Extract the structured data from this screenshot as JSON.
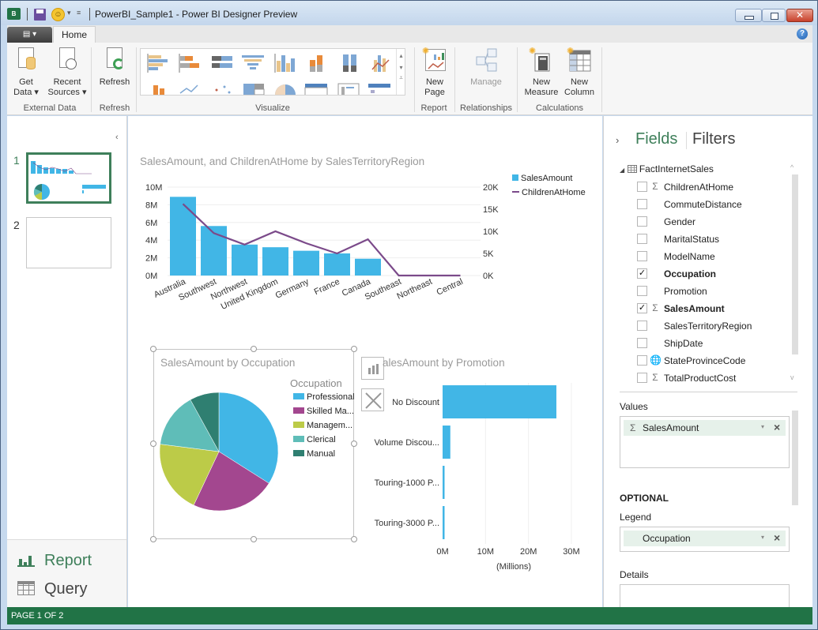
{
  "window": {
    "title": "PowerBI_Sample1 - Power BI Designer Preview",
    "app_icon_label": "B",
    "close_glyph": "✕"
  },
  "ribbon": {
    "file_menu_glyph": "▤ ▾",
    "tabs": [
      {
        "label": "Home",
        "active": true
      }
    ],
    "help_glyph": "?",
    "groups": {
      "external_data": {
        "label": "External Data",
        "buttons": [
          {
            "label": "Get\nData ▾",
            "line1": "Get",
            "line2": "Data ▾"
          },
          {
            "line1": "Recent",
            "line2": "Sources ▾"
          }
        ]
      },
      "refresh": {
        "label": "Refresh",
        "button": "Refresh"
      },
      "visualize": {
        "label": "Visualize"
      },
      "report": {
        "label": "Report",
        "line1": "New",
        "line2": "Page"
      },
      "relationships": {
        "label": "Relationships",
        "button": "Manage"
      },
      "calculations": {
        "label": "Calculations",
        "buttons": [
          {
            "line1": "New",
            "line2": "Measure"
          },
          {
            "line1": "New",
            "line2": "Column"
          }
        ]
      }
    }
  },
  "pages_panel": {
    "collapse_glyph": "‹",
    "pages": [
      {
        "number": "1",
        "active": true
      },
      {
        "number": "2",
        "active": false
      }
    ],
    "nav": [
      {
        "label": "Report",
        "active": true
      },
      {
        "label": "Query",
        "active": false
      }
    ]
  },
  "fields_panel": {
    "expand_glyph": "›",
    "tab_fields": "Fields",
    "tab_filters": "Filters",
    "table_name": "FactInternetSales",
    "fields": [
      {
        "name": "ChildrenAtHome",
        "type": "Σ",
        "checked": false
      },
      {
        "name": "CommuteDistance",
        "type": "",
        "checked": false
      },
      {
        "name": "Gender",
        "type": "",
        "checked": false
      },
      {
        "name": "MaritalStatus",
        "type": "",
        "checked": false
      },
      {
        "name": "ModelName",
        "type": "",
        "checked": false
      },
      {
        "name": "Occupation",
        "type": "",
        "checked": true
      },
      {
        "name": "Promotion",
        "type": "",
        "checked": false
      },
      {
        "name": "SalesAmount",
        "type": "Σ",
        "checked": true
      },
      {
        "name": "SalesTerritoryRegion",
        "type": "",
        "checked": false
      },
      {
        "name": "ShipDate",
        "type": "",
        "checked": false
      },
      {
        "name": "StateProvinceCode",
        "type": "🌐",
        "checked": false
      },
      {
        "name": "TotalProductCost",
        "type": "Σ",
        "checked": false
      }
    ],
    "values_label": "Values",
    "values_item": {
      "sigma": "Σ",
      "name": "SalesAmount"
    },
    "optional_label": "OPTIONAL",
    "legend_label": "Legend",
    "legend_item": {
      "name": "Occupation"
    },
    "details_label": "Details",
    "dropdown_glyph": "▾",
    "remove_glyph": "×",
    "check_glyph": "✓"
  },
  "status_bar": {
    "text": "PAGE 1 OF 2"
  },
  "chart_data": [
    {
      "type": "bar",
      "title": "SalesAmount, and ChildrenAtHome by SalesTerritoryRegion",
      "categories": [
        "Australia",
        "Southwest",
        "Northwest",
        "United Kingdom",
        "Germany",
        "France",
        "Canada",
        "Southeast",
        "Northeast",
        "Central"
      ],
      "series": [
        {
          "name": "SalesAmount",
          "kind": "bar",
          "axis": "left",
          "color": "#41b6e6",
          "values": [
            8.9,
            5.6,
            3.5,
            3.2,
            2.8,
            2.5,
            1.9,
            0,
            0,
            0
          ]
        },
        {
          "name": "ChildrenAtHome",
          "kind": "line",
          "axis": "right",
          "color": "#7b4a8a",
          "values": [
            16200,
            9600,
            7000,
            10000,
            7300,
            5000,
            8200,
            0,
            0,
            0
          ]
        }
      ],
      "left_axis": {
        "ticks": [
          "0M",
          "2M",
          "4M",
          "6M",
          "8M",
          "10M"
        ],
        "ylim": [
          0,
          10
        ],
        "units": "M"
      },
      "right_axis": {
        "ticks": [
          "0K",
          "5K",
          "10K",
          "15K",
          "20K"
        ],
        "ylim": [
          0,
          20000
        ]
      },
      "legend": "top-right",
      "grid": true
    },
    {
      "type": "pie",
      "title": "SalesAmount by Occupation",
      "legend_title": "Occupation",
      "legend": "right",
      "slices": [
        {
          "label": "Professional",
          "legend_label": "Professional",
          "value": 34,
          "color": "#41b6e6"
        },
        {
          "label": "Skilled Manual",
          "legend_label": "Skilled Ma...",
          "value": 23,
          "color": "#a3478f"
        },
        {
          "label": "Management",
          "legend_label": "Managem...",
          "value": 20,
          "color": "#bccb48"
        },
        {
          "label": "Clerical",
          "legend_label": "Clerical",
          "value": 15,
          "color": "#5fbdb8"
        },
        {
          "label": "Manual",
          "legend_label": "Manual",
          "value": 8,
          "color": "#2f7f71"
        }
      ]
    },
    {
      "type": "bar",
      "orientation": "horizontal",
      "title": "SalesAmount by Promotion",
      "title_visible": "alesAmount by Promotion",
      "categories": [
        "No Discount",
        "Volume Discou...",
        "Touring-1000 P...",
        "Touring-3000 P..."
      ],
      "values": [
        26.5,
        1.8,
        0.4,
        0.4
      ],
      "xlim": [
        0,
        30
      ],
      "x_ticks": [
        "0M",
        "10M",
        "20M",
        "30M"
      ],
      "xlabel": "(Millions)",
      "color": "#41b6e6"
    }
  ]
}
